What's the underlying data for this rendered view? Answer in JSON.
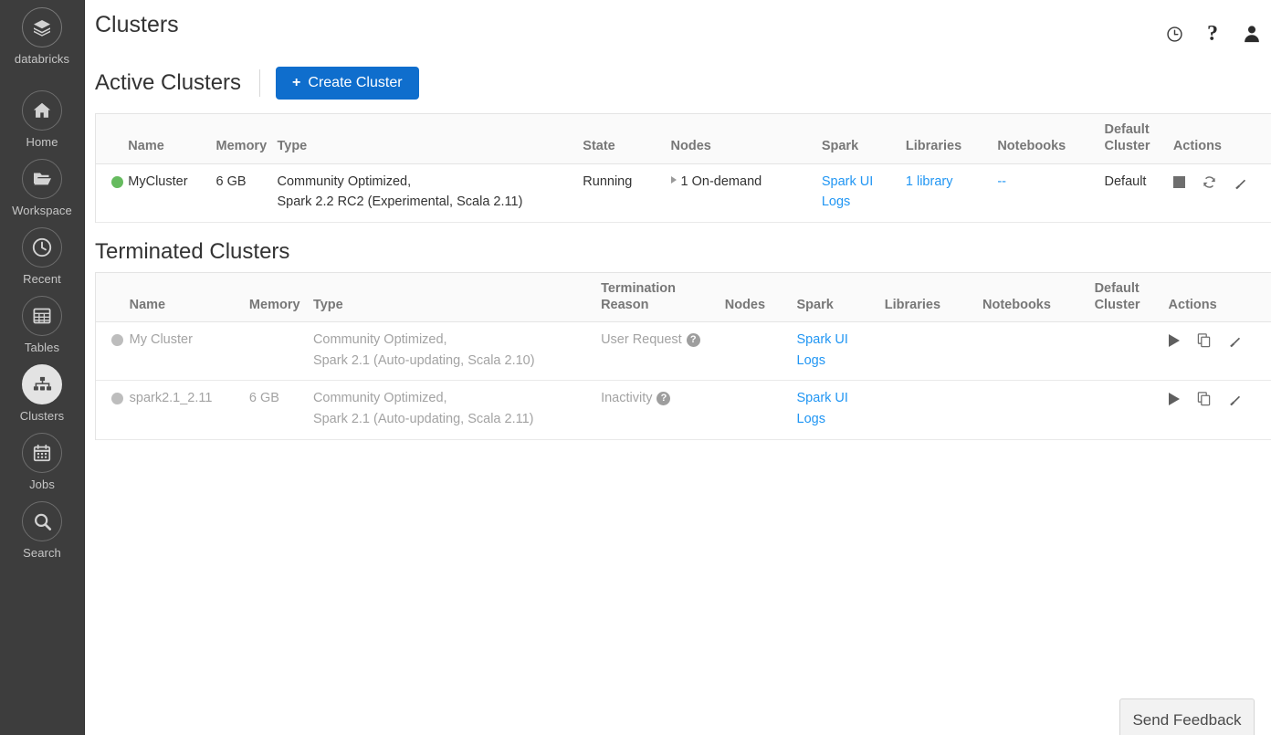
{
  "sidebar": {
    "brand": {
      "label": "databricks",
      "icon": "layers-icon"
    },
    "items": [
      {
        "label": "Home",
        "icon": "home-icon",
        "active": false
      },
      {
        "label": "Workspace",
        "icon": "folder-icon",
        "active": false
      },
      {
        "label": "Recent",
        "icon": "clock-icon",
        "active": false
      },
      {
        "label": "Tables",
        "icon": "table-icon",
        "active": false
      },
      {
        "label": "Clusters",
        "icon": "clusters-icon",
        "active": true
      },
      {
        "label": "Jobs",
        "icon": "calendar-icon",
        "active": false
      },
      {
        "label": "Search",
        "icon": "search-icon",
        "active": false
      }
    ]
  },
  "header": {
    "title": "Clusters",
    "icons": [
      {
        "name": "history-icon",
        "glyph": "clock"
      },
      {
        "name": "help-icon",
        "glyph": "?"
      },
      {
        "name": "account-icon",
        "glyph": "person"
      }
    ]
  },
  "active_section": {
    "title": "Active Clusters",
    "create_button": {
      "plus": "+",
      "label": "Create Cluster"
    },
    "columns": [
      "",
      "Name",
      "Memory",
      "Type",
      "State",
      "Nodes",
      "Spark",
      "Libraries",
      "Notebooks",
      "Default Cluster",
      "Actions"
    ],
    "column_lines": {
      "default_cluster_line1": "Default",
      "default_cluster_line2": "Cluster"
    },
    "rows": [
      {
        "status": "running",
        "name": "MyCluster",
        "memory": "6 GB",
        "type_line1": "Community Optimized,",
        "type_line2": "Spark 2.2 RC2 (Experimental, Scala 2.11)",
        "state": "Running",
        "nodes": "1 On-demand",
        "spark_ui": "Spark UI",
        "logs": "Logs",
        "libraries": "1 library",
        "notebooks": "--",
        "default_cluster": "Default",
        "actions": [
          "stop-icon",
          "restart-icon",
          "configure-icon"
        ]
      }
    ]
  },
  "terminated_section": {
    "title": "Terminated Clusters",
    "columns": [
      "",
      "Name",
      "Memory",
      "Type",
      "Termination Reason",
      "Nodes",
      "Spark",
      "Libraries",
      "Notebooks",
      "Default Cluster",
      "Actions"
    ],
    "column_lines": {
      "termination_reason_line1": "Termination",
      "termination_reason_line2": "Reason",
      "default_cluster_line1": "Default",
      "default_cluster_line2": "Cluster"
    },
    "rows": [
      {
        "status": "terminated",
        "name": "My Cluster",
        "memory": "",
        "type_line1": "Community Optimized,",
        "type_line2": "Spark 2.1 (Auto-updating, Scala 2.10)",
        "termination_reason": "User Request",
        "help_glyph": "?",
        "nodes": "",
        "spark_ui": "Spark UI",
        "logs": "Logs",
        "libraries": "",
        "notebooks": "",
        "default_cluster": "",
        "actions": [
          "start-icon",
          "clone-icon",
          "configure-icon"
        ]
      },
      {
        "status": "terminated",
        "name": "spark2.1_2.11",
        "memory": "6 GB",
        "type_line1": "Community Optimized,",
        "type_line2": "Spark 2.1 (Auto-updating, Scala 2.11)",
        "termination_reason": "Inactivity",
        "help_glyph": "?",
        "nodes": "",
        "spark_ui": "Spark UI",
        "logs": "Logs",
        "libraries": "",
        "notebooks": "",
        "default_cluster": "",
        "actions": [
          "start-icon",
          "clone-icon",
          "configure-icon"
        ]
      }
    ]
  },
  "feedback": {
    "label": "Send Feedback"
  },
  "colors": {
    "sidebar_bg": "#3d3d3d",
    "accent_blue": "#0f6ecd",
    "link_blue": "#2196f3",
    "running_green": "#66bb5f",
    "terminated_grey": "#bdbdbd",
    "text": "#333333",
    "muted_text": "#a3a3a3",
    "header_text": "#777777"
  }
}
